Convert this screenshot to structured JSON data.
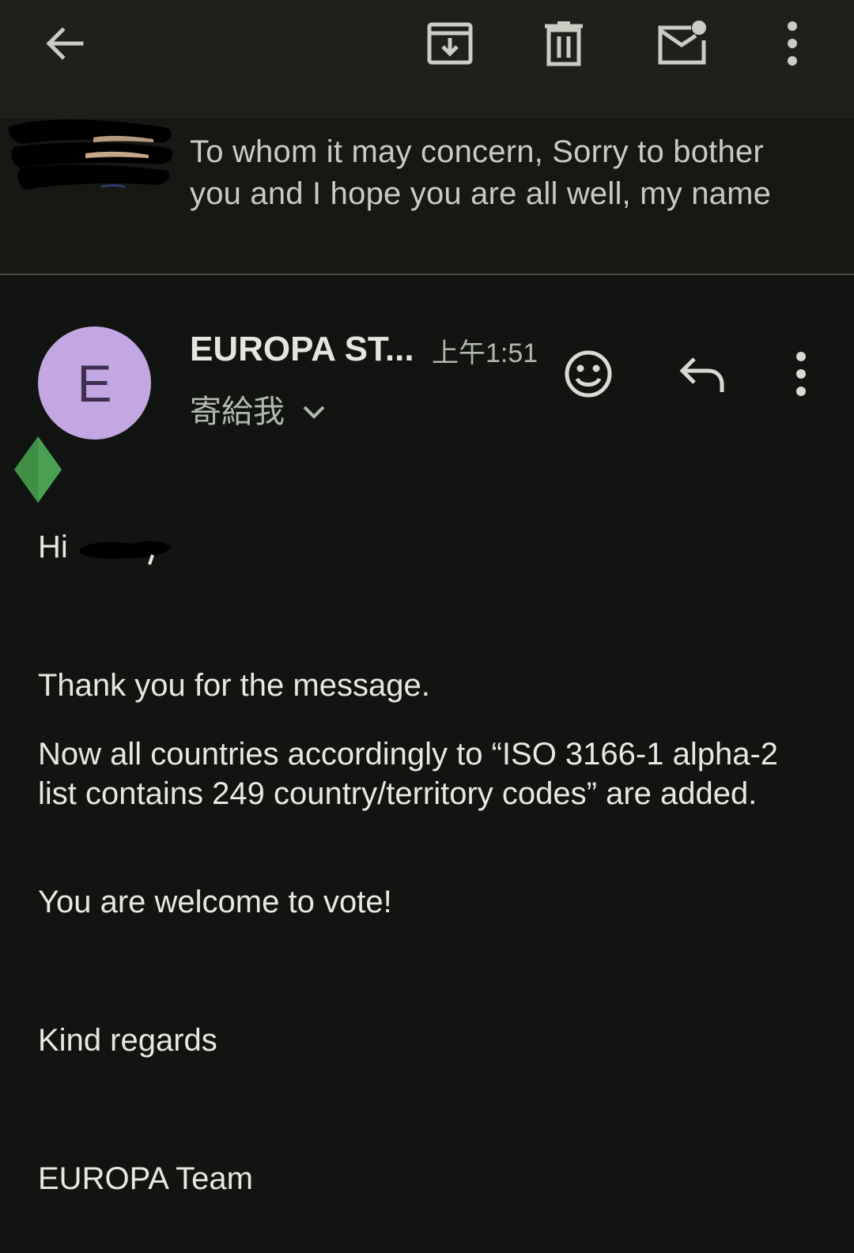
{
  "toolbar": {
    "back_icon": "arrow-back-icon",
    "archive_icon": "archive-icon",
    "delete_icon": "trash-icon",
    "mark_unread_icon": "mark-unread-icon",
    "more_icon": "more-vert-icon"
  },
  "previous_message": {
    "snippet": "To whom it may concern, Sorry to bother you and I hope you are all well, my name"
  },
  "message": {
    "avatar_letter": "E",
    "avatar_color": "#c2a7e2",
    "sender": "EUROPA ST...",
    "time": "上午1:51",
    "recipient_label": "寄給我",
    "body": {
      "greeting": "Hi",
      "line1": "Thank you for the message.",
      "line2": "Now all  countries accordingly to “ISO 3166-1 alpha-2 list contains 249 country/territory codes” are added.",
      "line3": "You are welcome to vote!",
      "closing": "Kind regards",
      "signature": "EUROPA Team"
    }
  },
  "colors": {
    "background": "#111410",
    "toolbar": "#1d201b",
    "text_primary": "#e6e9e1",
    "text_secondary": "#b3b8ae",
    "leaf_green": "#3f8f45"
  }
}
